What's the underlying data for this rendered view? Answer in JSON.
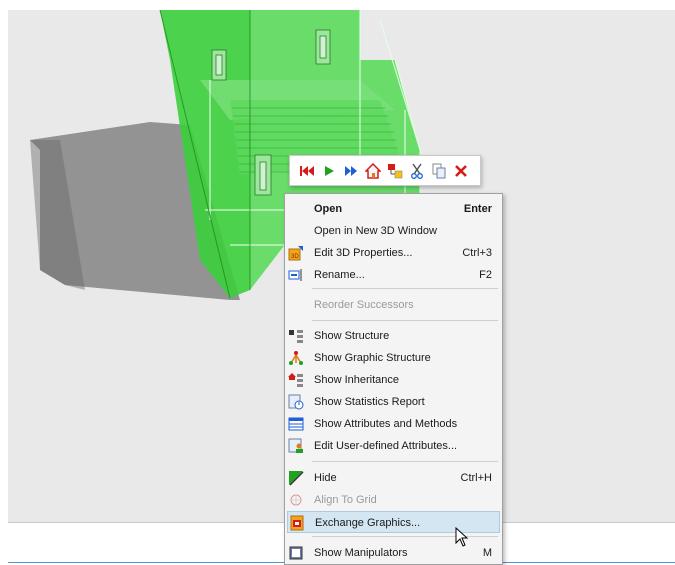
{
  "mini_toolbar": {
    "buttons": [
      {
        "icon": "first-icon"
      },
      {
        "icon": "play-icon"
      },
      {
        "icon": "fast-forward-icon"
      },
      {
        "icon": "home-icon"
      },
      {
        "icon": "structure-icon"
      },
      {
        "icon": "cut-icon"
      },
      {
        "icon": "copy-icon"
      },
      {
        "icon": "delete-icon"
      }
    ]
  },
  "context_menu": {
    "items": [
      {
        "label": "Open",
        "shortcut": "Enter"
      },
      {
        "label": "Open in New 3D Window",
        "shortcut": ""
      },
      {
        "label": "Edit 3D Properties...",
        "shortcut": "Ctrl+3"
      },
      {
        "label": "Rename...",
        "shortcut": "F2"
      },
      {
        "label": "Reorder Successors",
        "shortcut": ""
      },
      {
        "label": "Show Structure",
        "shortcut": ""
      },
      {
        "label": "Show Graphic Structure",
        "shortcut": ""
      },
      {
        "label": "Show Inheritance",
        "shortcut": ""
      },
      {
        "label": "Show Statistics Report",
        "shortcut": ""
      },
      {
        "label": "Show Attributes and Methods",
        "shortcut": ""
      },
      {
        "label": "Edit User-defined Attributes...",
        "shortcut": ""
      },
      {
        "label": "Hide",
        "shortcut": "Ctrl+H"
      },
      {
        "label": "Align To Grid",
        "shortcut": ""
      },
      {
        "label": "Exchange Graphics...",
        "shortcut": ""
      },
      {
        "label": "Show Manipulators",
        "shortcut": "M"
      }
    ]
  },
  "colors": {
    "viewport_bg": "#e9e9e9",
    "model_green": "#3ccf3c",
    "menu_bg": "#f4f4f4",
    "menu_hover": "#d4e6f2",
    "status_accent": "#4f96d8"
  }
}
